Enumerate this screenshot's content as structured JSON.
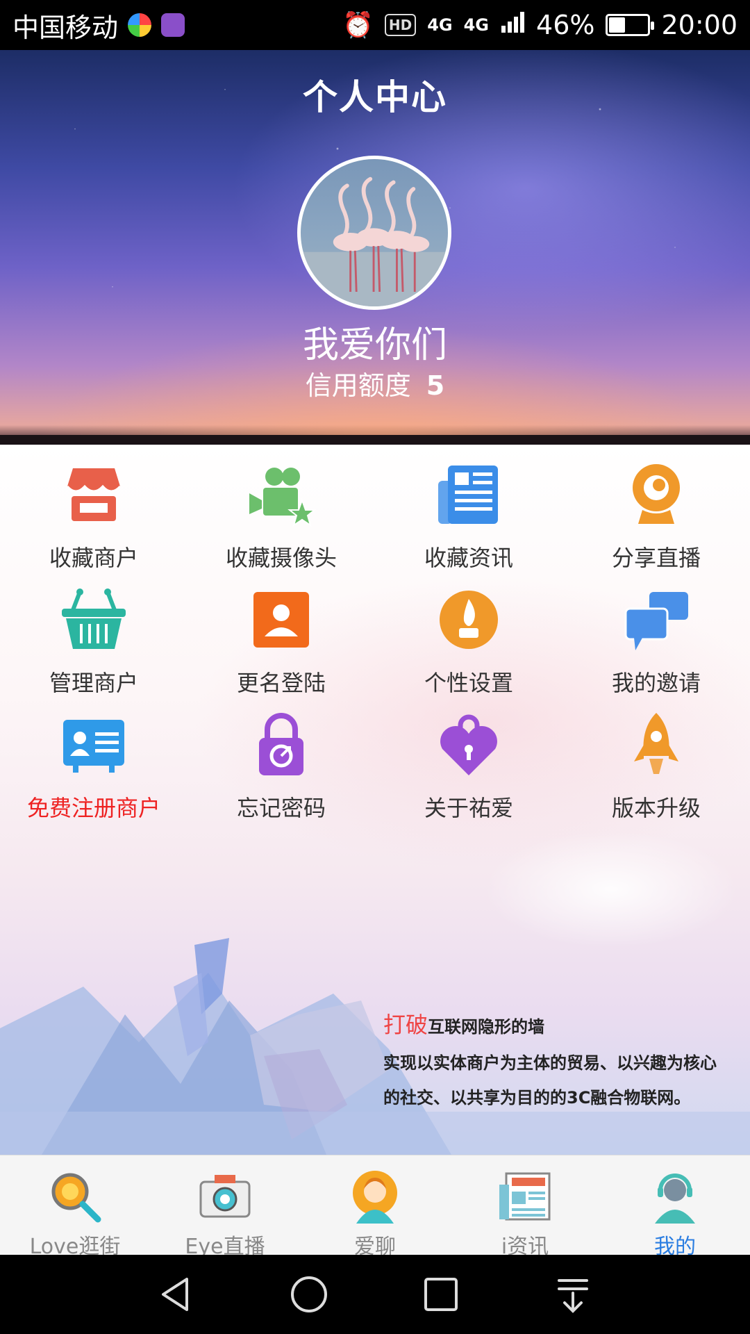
{
  "status_bar": {
    "carrier": "中国移动",
    "hd": "HD",
    "network_1": "4G",
    "network_2": "4G",
    "battery": "46%",
    "battery_level": 0.46,
    "time": "20:00"
  },
  "header": {
    "title": "个人中心",
    "username": "我爱你们",
    "credit_label": "信用额度",
    "credit_value": "5"
  },
  "grid": [
    {
      "label": "收藏商户",
      "icon": "shop-icon",
      "color": "#e8604a"
    },
    {
      "label": "收藏摄像头",
      "icon": "video-camera-icon",
      "color": "#6cbf6c"
    },
    {
      "label": "收藏资讯",
      "icon": "newspaper-icon",
      "color": "#3b8de8"
    },
    {
      "label": "分享直播",
      "icon": "webcam-icon",
      "color": "#f0992a"
    },
    {
      "label": "管理商户",
      "icon": "basket-icon",
      "color": "#2bb5a0"
    },
    {
      "label": "更名登陆",
      "icon": "user-card-icon",
      "color": "#f26a1b"
    },
    {
      "label": "个性设置",
      "icon": "flame-icon",
      "color": "#f0992a"
    },
    {
      "label": "我的邀请",
      "icon": "chat-bubbles-icon",
      "color": "#4a90e8"
    },
    {
      "label": "免费注册商户",
      "icon": "id-card-icon",
      "color": "#2f9ae8",
      "red": true
    },
    {
      "label": "忘记密码",
      "icon": "lock-icon",
      "color": "#9b4fd6"
    },
    {
      "label": "关于祐爱",
      "icon": "heart-lock-icon",
      "color": "#9b4fd6"
    },
    {
      "label": "版本升级",
      "icon": "rocket-icon",
      "color": "#f0992a"
    }
  ],
  "slogan": {
    "highlight": "打破",
    "line1": "互联网隐形的墙",
    "line2": "实现以实体商户为主体的贸易、以兴趣为核心",
    "line3": "的社交、以共享为目的的3C融合物联网。"
  },
  "tabs": [
    {
      "label": "Love逛街",
      "icon": "magnifier-icon",
      "active": false
    },
    {
      "label": "Eye直播",
      "icon": "camera-icon",
      "active": false
    },
    {
      "label": "爱聊",
      "icon": "chat-avatar-icon",
      "active": false
    },
    {
      "label": "i资讯",
      "icon": "news-icon",
      "active": false
    },
    {
      "label": "我的",
      "icon": "headset-user-icon",
      "active": true
    }
  ],
  "colors": {
    "active_tab": "#2a7de1",
    "register_red": "#ee2222"
  }
}
